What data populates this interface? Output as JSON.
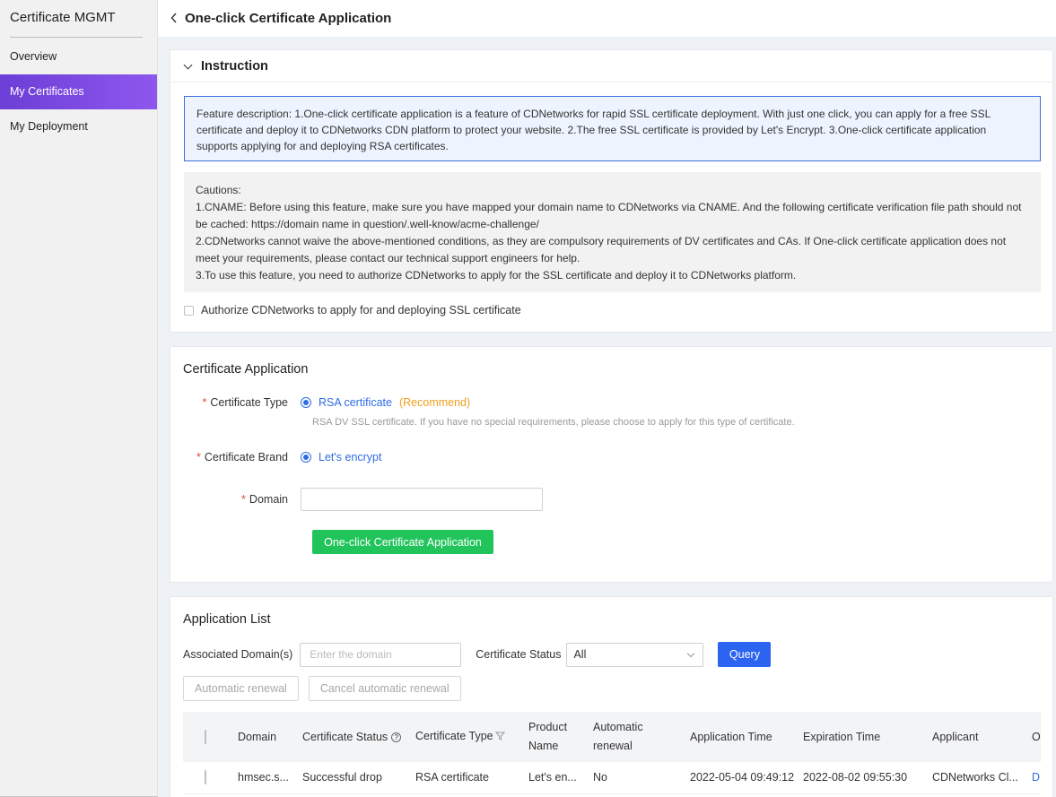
{
  "sidebar": {
    "title": "Certificate MGMT",
    "items": [
      {
        "label": "Overview",
        "active": false
      },
      {
        "label": "My Certificates",
        "active": true
      },
      {
        "label": "My Deployment",
        "active": false
      }
    ]
  },
  "header": {
    "title": "One-click Certificate Application"
  },
  "instruction": {
    "title": "Instruction",
    "feature": "Feature description: 1.One-click certificate application is a feature of CDNetworks for rapid SSL certificate deployment. With just one click, you can apply for a free SSL certificate and deploy it to CDNetworks CDN platform to protect your website. 2.The free SSL certificate is provided by Let's Encrypt. 3.One-click certificate application supports applying for and deploying RSA certificates.",
    "cautions": [
      "Cautions:",
      "1.CNAME: Before using this feature, make sure you have mapped your domain name to CDNetworks via CNAME. And the following certificate verification file path should not be cached: https://domain name in question/.well-know/acme-challenge/",
      "2.CDNetworks cannot waive the above-mentioned conditions, as they are compulsory requirements of DV certificates and CAs. If One-click certificate application does not meet your requirements, please contact our technical support engineers for help.",
      "3.To use this feature, you need to authorize CDNetworks to apply for the SSL certificate and deploy it to CDNetworks platform."
    ],
    "authorize_label": "Authorize CDNetworks to apply for and deploying SSL certificate"
  },
  "application": {
    "title": "Certificate Application",
    "type_label": "Certificate Type",
    "type_value": "RSA certificate",
    "type_recommend": "(Recommend)",
    "type_hint": "RSA DV SSL certificate. If you have no special requirements, please choose to apply for this type of certificate.",
    "brand_label": "Certificate Brand",
    "brand_value": "Let's encrypt",
    "domain_label": "Domain",
    "domain_value": "",
    "required_mark": "*",
    "submit_label": "One-click Certificate Application"
  },
  "list": {
    "title": "Application List",
    "domain_filter_label": "Associated Domain(s)",
    "domain_filter_placeholder": "Enter the domain",
    "status_filter_label": "Certificate Status",
    "status_filter_value": "All",
    "query_label": "Query",
    "auto_renew_label": "Automatic renewal",
    "cancel_renew_label": "Cancel automatic renewal",
    "columns": {
      "domain": "Domain",
      "status": "Certificate Status",
      "type": "Certificate Type",
      "product": "Product Name",
      "renewal": "Automatic renewal",
      "app_time": "Application Time",
      "exp_time": "Expiration Time",
      "applicant": "Applicant",
      "operation": "Operation"
    },
    "rows": [
      {
        "domain": "hmsec.s...",
        "status": "Successful drop",
        "type": "RSA certificate",
        "product": "Let's en...",
        "renewal": "No",
        "app_time": "2022-05-04 09:49:12",
        "exp_time": "2022-08-02 09:55:30",
        "applicant": "CDNetworks Cl...",
        "operation": "Details"
      }
    ]
  },
  "icons": {
    "back": "chevron-left-icon",
    "collapse": "chevron-down-icon",
    "help": "question-circle-icon",
    "filter": "filter-icon"
  },
  "colors": {
    "nav_active": "#7b4ae2",
    "primary": "#2c63f0",
    "success": "#21c45b",
    "recommend": "#f0a020",
    "required": "#e8453c"
  }
}
